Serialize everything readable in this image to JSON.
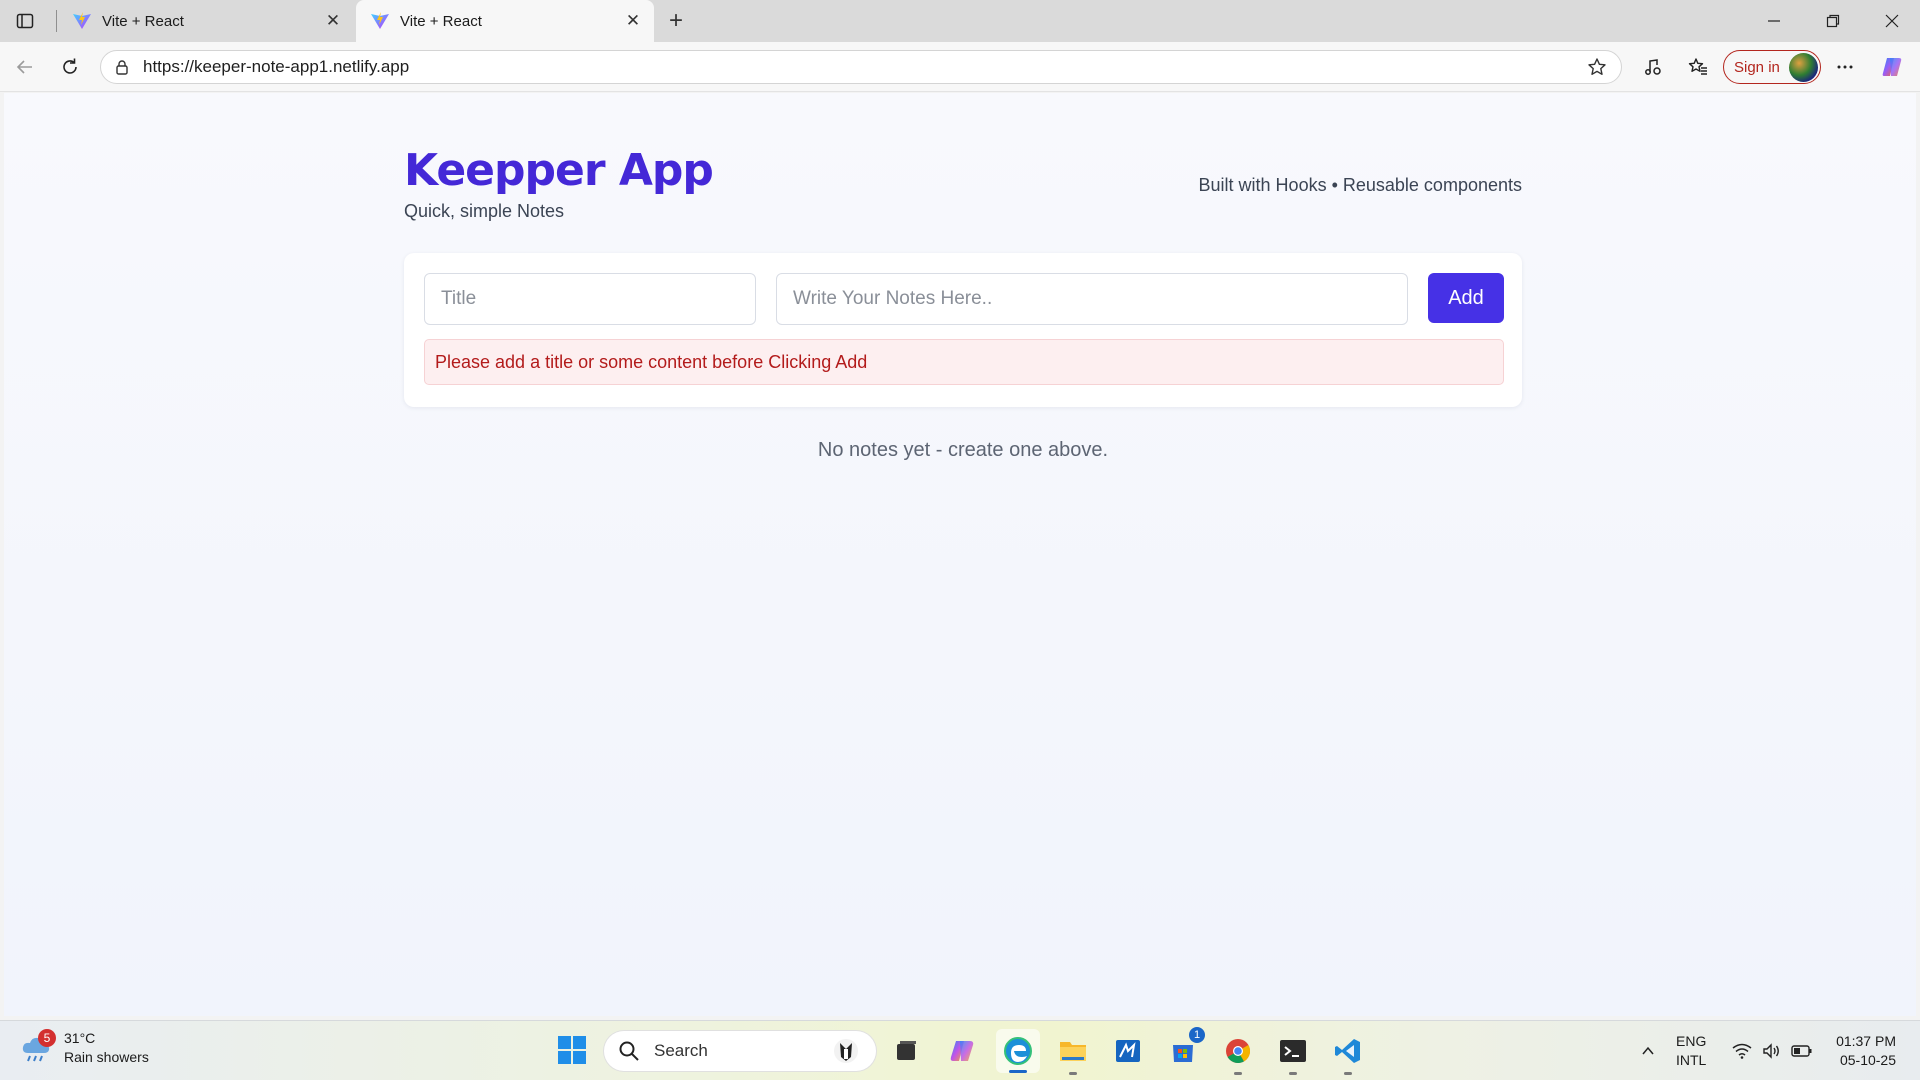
{
  "browser": {
    "tabs": [
      {
        "title": "Vite + React",
        "active": false
      },
      {
        "title": "Vite + React",
        "active": true
      }
    ],
    "url": "https://keeper-note-app1.netlify.app",
    "signin_label": "Sign in"
  },
  "app": {
    "brand": "Keepper App",
    "tagline": "Quick, simple Notes",
    "header_right": "Built with Hooks • Reusable components",
    "form": {
      "title_placeholder": "Title",
      "title_value": "",
      "note_placeholder": "Write Your Notes Here..",
      "note_value": "",
      "add_label": "Add"
    },
    "alert": "Please add a title or some content before Clicking Add",
    "empty_message": "No notes yet - create one above."
  },
  "taskbar": {
    "weather": {
      "badge": "5",
      "temp": "31°C",
      "condition": "Rain showers"
    },
    "search_label": "Search",
    "store_badge": "1",
    "lang_line1": "ENG",
    "lang_line2": "INTL",
    "time": "01:37 PM",
    "date": "05-10-25"
  },
  "colors": {
    "brand": "#4428d7",
    "add_button": "#4631e6",
    "alert_text": "#b31b1b",
    "alert_bg": "#fdeff0"
  }
}
